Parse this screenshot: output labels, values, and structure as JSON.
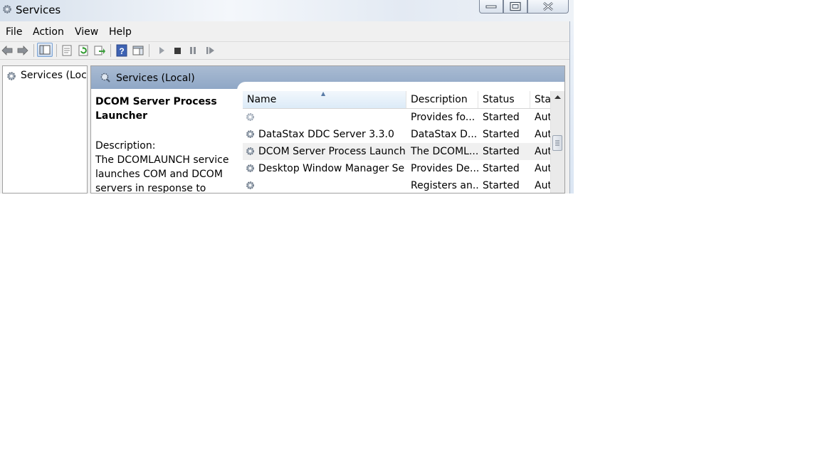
{
  "window": {
    "title": "Services",
    "colors": {
      "title_bar": "#e3eaf3",
      "panel_header": "#9db2cd",
      "selection": "#f0f0f0"
    }
  },
  "menu": [
    "File",
    "Action",
    "View",
    "Help"
  ],
  "toolbar": {
    "icons": [
      "back-arrow-icon",
      "forward-arrow-icon",
      "show-hide-console-tree-icon",
      "properties-icon",
      "refresh-icon",
      "export-list-icon",
      "help-icon",
      "show-hide-action-pane-icon",
      "start-service-icon",
      "stop-service-icon",
      "pause-service-icon",
      "resume-service-icon"
    ]
  },
  "tree": {
    "root_label": "Services (Loca"
  },
  "panel": {
    "title": "Services (Local)",
    "detail": {
      "service_name_line1": "DCOM Server Process",
      "service_name_line2": "Launcher",
      "description_label": "Description:",
      "description_line1": "The DCOMLAUNCH service",
      "description_line2": "launches COM and DCOM",
      "description_line3": "servers in response to object"
    }
  },
  "list": {
    "columns": [
      "Name",
      "Description",
      "Status",
      "Sta"
    ],
    "rows": [
      {
        "name": "",
        "description": "Provides fo...",
        "status": "Started",
        "startup": "Aut"
      },
      {
        "name": "DataStax DDC Server 3.3.0",
        "description": "DataStax D...",
        "status": "Started",
        "startup": "Aut"
      },
      {
        "name": "DCOM Server Process Launcher",
        "description": "The DCOML...",
        "status": "Started",
        "startup": "Aut"
      },
      {
        "name": "Desktop Window Manager Se...",
        "description": "Provides De...",
        "status": "Started",
        "startup": "Aut"
      },
      {
        "name": "",
        "description": "Registers an...",
        "status": "Started",
        "startup": "Aut"
      }
    ]
  }
}
